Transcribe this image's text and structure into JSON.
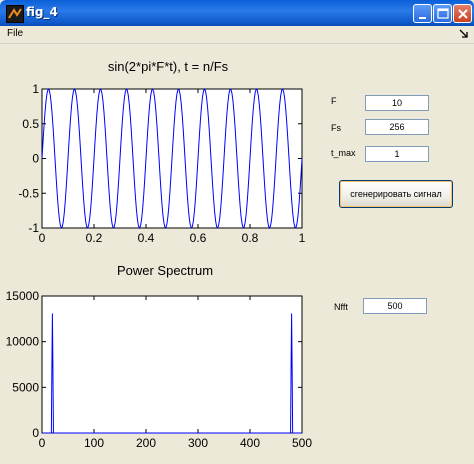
{
  "window": {
    "title": "fig_4",
    "controls": [
      "minimize",
      "maximize",
      "close"
    ]
  },
  "menubar": {
    "items": [
      "File"
    ]
  },
  "controls": {
    "F": {
      "label": "F",
      "value": "10"
    },
    "Fs": {
      "label": "Fs",
      "value": "256"
    },
    "t_max": {
      "label": "t_max",
      "value": "1"
    },
    "generate_button": "сгенерировать сигнал",
    "Nfft": {
      "label": "Nfft",
      "value": "500"
    }
  },
  "chart_data": [
    {
      "type": "line",
      "title": "sin(2*pi*F*t), t = n/Fs",
      "xlabel": "",
      "ylabel": "",
      "xlim": [
        0,
        1
      ],
      "ylim": [
        -1,
        1
      ],
      "x_ticks": [
        "0",
        "0.2",
        "0.4",
        "0.6",
        "0.8",
        "1"
      ],
      "y_ticks": [
        "1",
        "0.5",
        "0",
        "-0.5",
        "-1"
      ],
      "series": [
        {
          "function": "sin(2*pi*F*t)",
          "F": 10,
          "Fs": 256,
          "t_max": 1,
          "color": "#0000ff"
        }
      ],
      "grid": false
    },
    {
      "type": "line",
      "title": "Power Spectrum",
      "xlabel": "",
      "ylabel": "",
      "xlim": [
        0,
        500
      ],
      "ylim": [
        0,
        15000
      ],
      "x_ticks": [
        "0",
        "100",
        "200",
        "300",
        "400",
        "500"
      ],
      "y_ticks": [
        "15000",
        "10000",
        "5000",
        "0"
      ],
      "series": [
        {
          "color": "#0000ff",
          "baseline": 0,
          "peaks": [
            {
              "x": 19,
              "y": 7200
            },
            {
              "x": 20,
              "y": 13100
            },
            {
              "x": 21,
              "y": 7200
            },
            {
              "x": 479,
              "y": 7200
            },
            {
              "x": 480,
              "y": 13100
            },
            {
              "x": 481,
              "y": 7200
            }
          ]
        }
      ],
      "grid": false
    }
  ]
}
